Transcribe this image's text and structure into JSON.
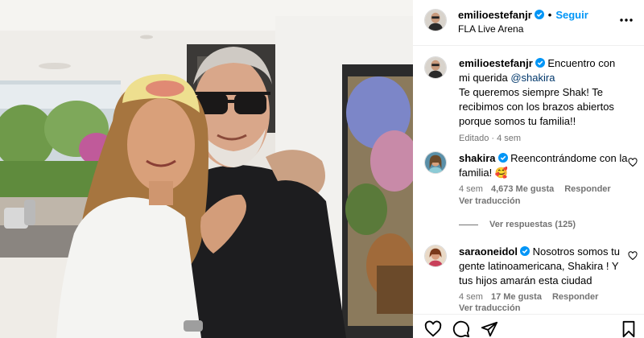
{
  "post": {
    "author": "emilioestefanjr",
    "follow_label": "Seguir",
    "location": "FLA Live Arena",
    "more_icon": "more-horizontal-icon"
  },
  "caption": {
    "author": "emilioestefanjr",
    "text_start": "Encuentro con mi querida",
    "mention": "@shakira",
    "text_end": "Te queremos siempre Shak! Te recibimos con los brazos abiertos porque somos tu familia!!",
    "edited": "Editado · 4 sem"
  },
  "comments": [
    {
      "user": "shakira",
      "text": "Reencontrándome con la familia! 🥰",
      "time": "4 sem",
      "likes": "4,673 Me gusta",
      "reply": "Responder",
      "translate": "Ver traducción",
      "view_replies": "Ver respuestas (125)"
    },
    {
      "user": "saraoneidol",
      "text": "Nosotros somos tu gente latinoamericana, Shakira ! Y tus hijos amarán esta ciudad",
      "time": "4 sem",
      "likes": "17 Me gusta",
      "reply": "Responder",
      "translate": "Ver traducción"
    }
  ],
  "icons": {
    "like": "heart-icon",
    "comment": "comment-icon",
    "share": "share-icon",
    "save": "bookmark-icon",
    "verified": "verified-badge-icon"
  },
  "colors": {
    "accent": "#0095f6",
    "verified": "#0095f6",
    "muted": "#737373"
  }
}
